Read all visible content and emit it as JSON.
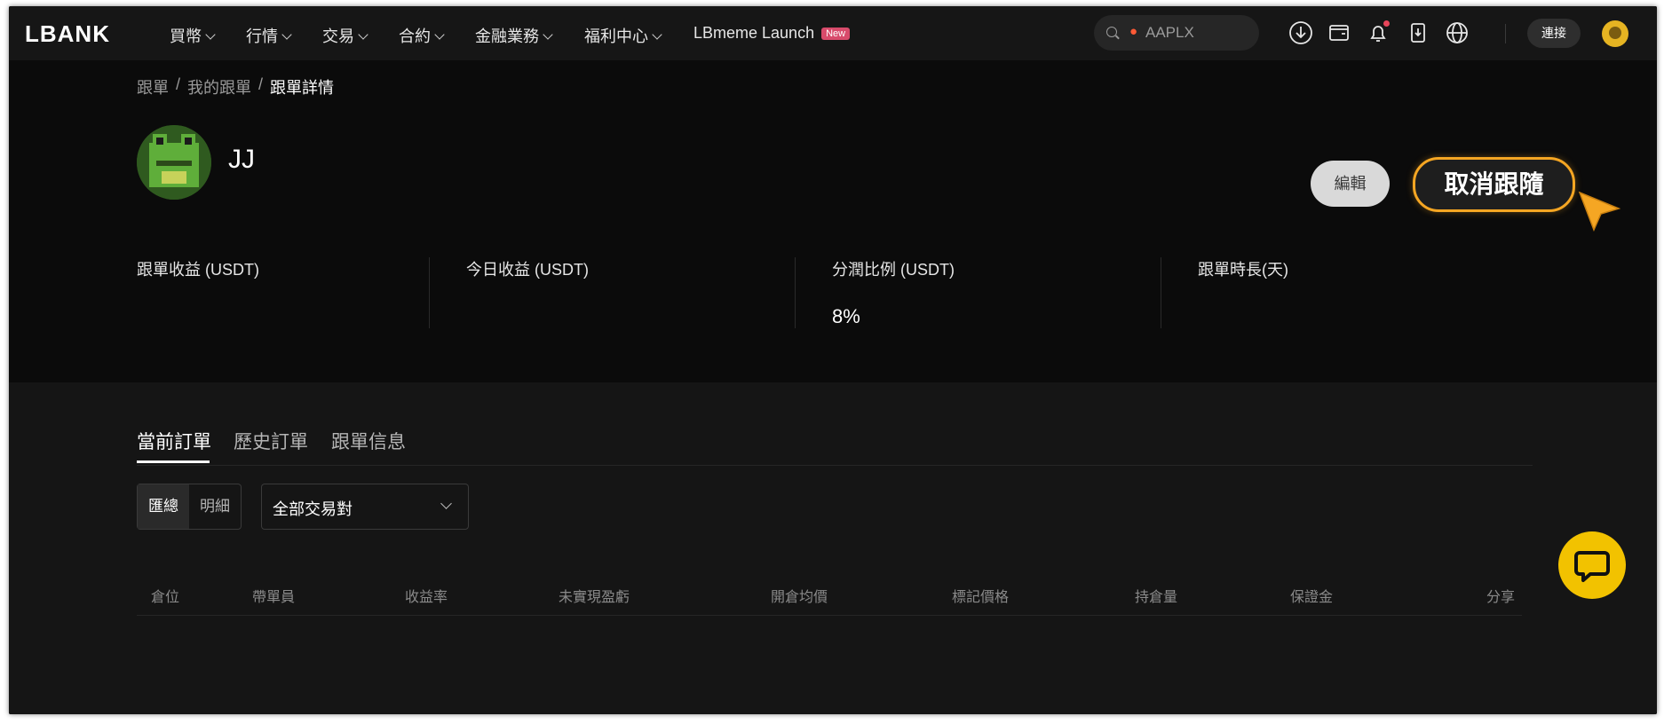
{
  "nav": {
    "logo": "LBANK",
    "items": [
      {
        "label": "買幣"
      },
      {
        "label": "行情"
      },
      {
        "label": "交易"
      },
      {
        "label": "合約"
      },
      {
        "label": "金融業務"
      },
      {
        "label": "福利中心"
      }
    ],
    "launch": {
      "label": "LBmeme Launch",
      "badge": "New"
    },
    "search": {
      "value": "AAPLX"
    },
    "connect_label": "連接"
  },
  "breadcrumb": {
    "items": [
      "跟單",
      "我的跟單",
      "跟單詳情"
    ],
    "separator": "/"
  },
  "profile": {
    "name": "JJ",
    "edit_label": "編輯",
    "unfollow_label": "取消跟隨"
  },
  "stats": [
    {
      "label": "跟單收益 (USDT)",
      "value": ""
    },
    {
      "label": "今日收益 (USDT)",
      "value": ""
    },
    {
      "label": "分潤比例 (USDT)",
      "value": "8%"
    },
    {
      "label": "跟單時長(天)",
      "value": ""
    }
  ],
  "tabs": [
    {
      "label": "當前訂單",
      "active": true
    },
    {
      "label": "歷史訂單",
      "active": false
    },
    {
      "label": "跟單信息",
      "active": false
    }
  ],
  "filters": {
    "segment": [
      "匯總",
      "明細"
    ],
    "pair_select": "全部交易對"
  },
  "table": {
    "columns": [
      "倉位",
      "帶單員",
      "收益率",
      "未實現盈虧",
      "開倉均價",
      "標記價格",
      "持倉量",
      "保證金",
      "分享"
    ]
  },
  "colors": {
    "accent": "#f5a623",
    "chat": "#f2c200",
    "background": "#0b0b0b"
  }
}
